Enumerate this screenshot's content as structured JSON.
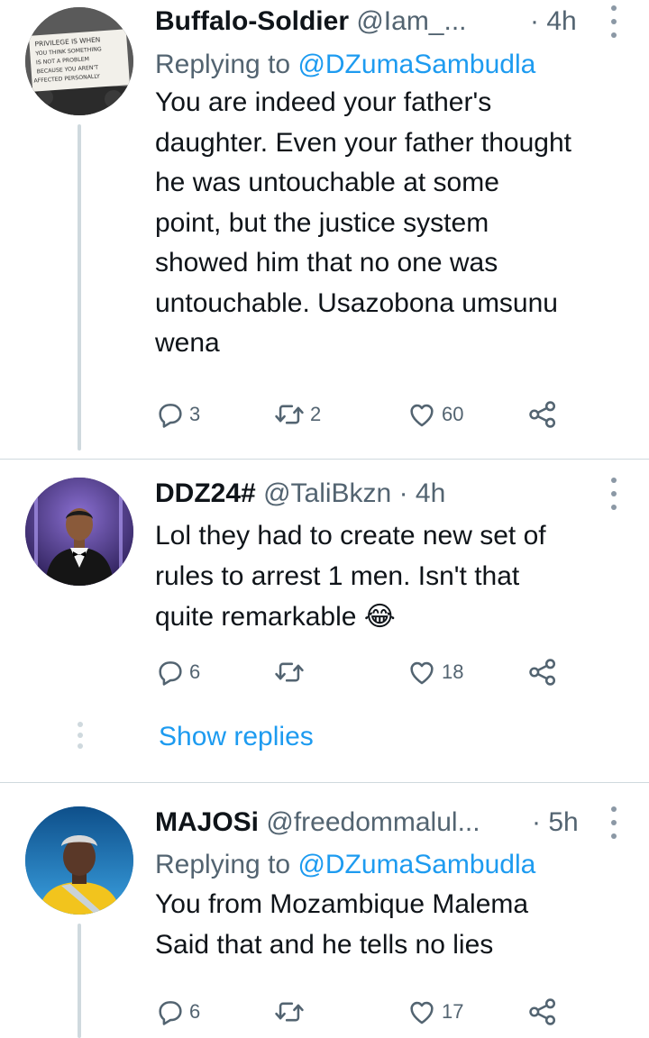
{
  "tweets": [
    {
      "name": "Buffalo-Soldier",
      "handle": "@Iam_...",
      "time": "· 4h",
      "replying_prefix": "Replying to",
      "replying_to": "@DZumaSambudla",
      "text_lines": [
        "You are indeed your father's",
        "daughter. Even your father thought",
        "he was untouchable at some",
        "point, but the justice system",
        "showed him that no one was",
        "untouchable. Usazobona umsunu",
        "wena"
      ],
      "replies": "3",
      "retweets": "2",
      "likes": "60",
      "avatar_sign_lines": [
        "PRIVILEGE IS WHEN",
        "YOU THINK SOMETHING",
        "IS NOT A PROBLEM",
        "BECAUSE YOU AREN'T",
        "AFFECTED PERSONALLY"
      ]
    },
    {
      "name": "DDZ24#",
      "handle": "@TaliBkzn",
      "time": "· 4h",
      "text_lines": [
        "Lol they had to create new set of",
        "rules to arrest 1 men. Isn't that",
        "quite remarkable"
      ],
      "emoji": "😂",
      "replies": "6",
      "retweets": "",
      "likes": "18"
    },
    {
      "name": "MAJOSi",
      "handle": "@freedommalul...",
      "time": "· 5h",
      "replying_prefix": "Replying to",
      "replying_to": "@DZumaSambudla",
      "text_lines": [
        "You from Mozambique Malema",
        "Said that and he tells no lies"
      ],
      "replies": "6",
      "retweets": "",
      "likes": "17"
    }
  ],
  "show_replies": "Show replies",
  "colors": {
    "text": "#0f1419",
    "secondary": "#536471",
    "link": "#1d9bf0",
    "divider": "#cfd9de"
  },
  "icons": [
    "reply-icon",
    "retweet-icon",
    "like-icon",
    "share-icon",
    "more-icon"
  ]
}
